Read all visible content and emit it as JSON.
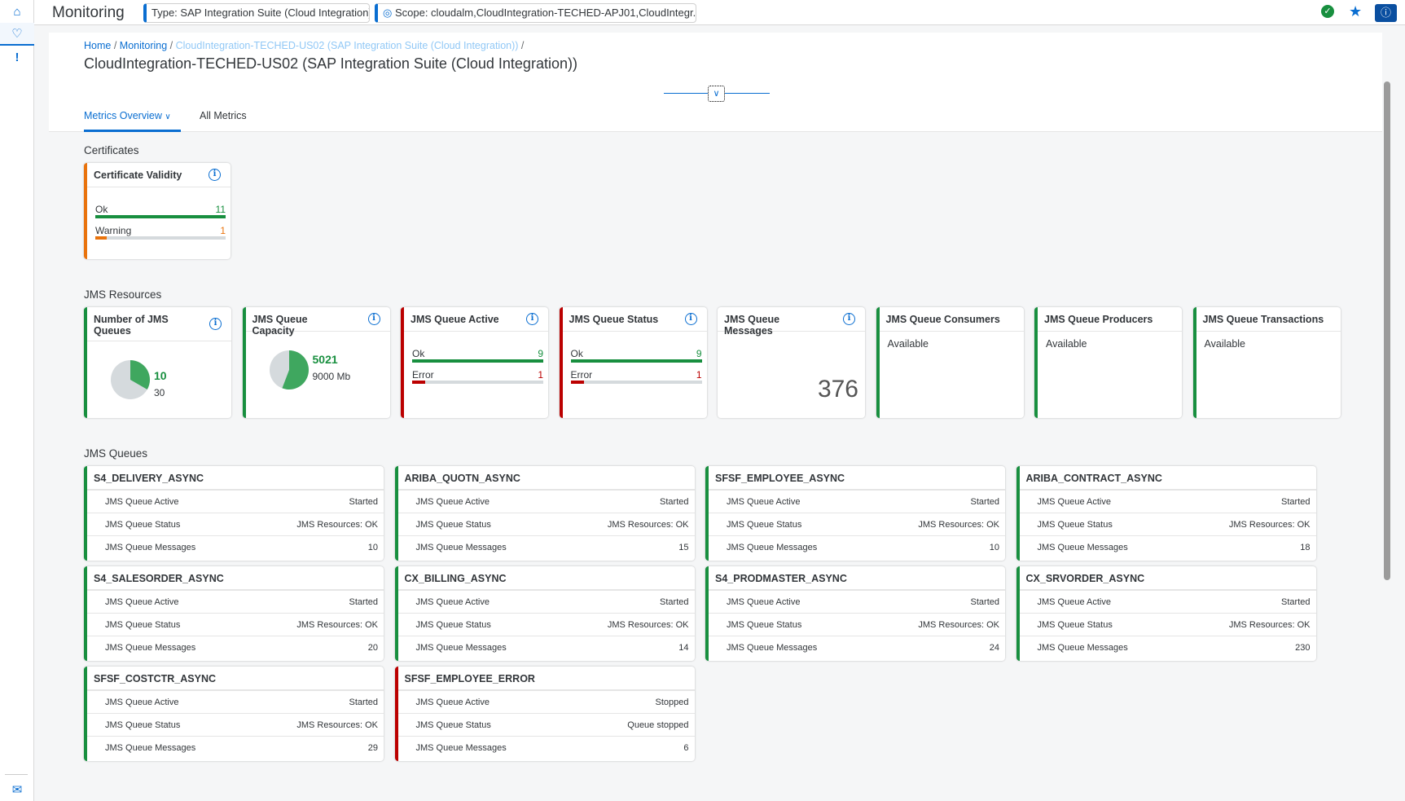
{
  "shell": {
    "app_title": "Monitoring",
    "type_token": "Type: SAP Integration Suite (Cloud Integration)",
    "scope_token": "Scope: cloudalm,CloudIntegration-TECHED-APJ01,CloudIntegr...",
    "sidebar_icons": [
      "home-icon",
      "monitoring-icon",
      "alert-icon",
      "mail-icon"
    ]
  },
  "header": {
    "breadcrumb": [
      "Home",
      "Monitoring",
      "CloudIntegration-TECHED-US02 (SAP Integration Suite (Cloud Integration))"
    ],
    "sep": "/",
    "title": "CloudIntegration-TECHED-US02 (SAP Integration Suite (Cloud Integration))",
    "tabs": [
      "Metrics Overview",
      "All Metrics"
    ]
  },
  "colors": {
    "accent": "#0a6ed1",
    "ok": "#188f3f",
    "error": "#bb0000",
    "warning": "#e9730c"
  },
  "sections": {
    "certificates": "Certificates",
    "jms_resources": "JMS Resources",
    "jms_queues": "JMS Queues"
  },
  "certificate": {
    "title": "Certificate Validity",
    "status": "warning",
    "rows": [
      {
        "label": "Ok",
        "value": "11",
        "fraction": 1,
        "color": "ok"
      },
      {
        "label": "Warning",
        "value": "1",
        "fraction": 0.09,
        "color": "warning"
      }
    ]
  },
  "resources": [
    {
      "title": "Number of JMS Queues",
      "status": "ok",
      "type": "pie",
      "value": "10",
      "total": "30",
      "fraction": 0.333,
      "info": true
    },
    {
      "title": "JMS Queue Capacity",
      "status": "ok",
      "type": "pie",
      "value": "5021",
      "total": "9000 Mb",
      "fraction": 0.558,
      "info": true
    },
    {
      "title": "JMS Queue Active",
      "status": "error",
      "type": "bars",
      "info": true,
      "rows": [
        {
          "label": "Ok",
          "value": "9",
          "fraction": 1,
          "color": "ok"
        },
        {
          "label": "Error",
          "value": "1",
          "fraction": 0.1,
          "color": "error"
        }
      ]
    },
    {
      "title": "JMS Queue Status",
      "status": "error",
      "type": "bars",
      "info": true,
      "rows": [
        {
          "label": "Ok",
          "value": "9",
          "fraction": 1,
          "color": "ok"
        },
        {
          "label": "Error",
          "value": "1",
          "fraction": 0.1,
          "color": "error"
        }
      ]
    },
    {
      "title": "JMS Queue Messages",
      "status": "none",
      "type": "number",
      "value": "376",
      "info": true
    },
    {
      "title": "JMS Queue Consumers",
      "status": "ok",
      "type": "text",
      "value": "Available"
    },
    {
      "title": "JMS Queue Producers",
      "status": "ok",
      "type": "text",
      "value": "Available"
    },
    {
      "title": "JMS Queue Transactions",
      "status": "ok",
      "type": "text",
      "value": "Available"
    }
  ],
  "queue_labels": [
    "JMS Queue Active",
    "JMS Queue Status",
    "JMS Queue Messages"
  ],
  "queues": [
    {
      "name": "S4_DELIVERY_ASYNC",
      "status": "ok",
      "values": [
        "Started",
        "JMS Resources: OK",
        "10"
      ]
    },
    {
      "name": "ARIBA_QUOTN_ASYNC",
      "status": "ok",
      "values": [
        "Started",
        "JMS Resources: OK",
        "15"
      ]
    },
    {
      "name": "SFSF_EMPLOYEE_ASYNC",
      "status": "ok",
      "values": [
        "Started",
        "JMS Resources: OK",
        "10"
      ]
    },
    {
      "name": "ARIBA_CONTRACT_ASYNC",
      "status": "ok",
      "values": [
        "Started",
        "JMS Resources: OK",
        "18"
      ]
    },
    {
      "name": "S4_SALESORDER_ASYNC",
      "status": "ok",
      "values": [
        "Started",
        "JMS Resources: OK",
        "20"
      ]
    },
    {
      "name": "CX_BILLING_ASYNC",
      "status": "ok",
      "values": [
        "Started",
        "JMS Resources: OK",
        "14"
      ]
    },
    {
      "name": "S4_PRODMASTER_ASYNC",
      "status": "ok",
      "values": [
        "Started",
        "JMS Resources: OK",
        "24"
      ]
    },
    {
      "name": "CX_SRVORDER_ASYNC",
      "status": "ok",
      "values": [
        "Started",
        "JMS Resources: OK",
        "230"
      ]
    },
    {
      "name": "SFSF_COSTCTR_ASYNC",
      "status": "ok",
      "values": [
        "Started",
        "JMS Resources: OK",
        "29"
      ]
    },
    {
      "name": "SFSF_EMPLOYEE_ERROR",
      "status": "error",
      "values": [
        "Stopped",
        "Queue stopped",
        "6"
      ]
    }
  ]
}
